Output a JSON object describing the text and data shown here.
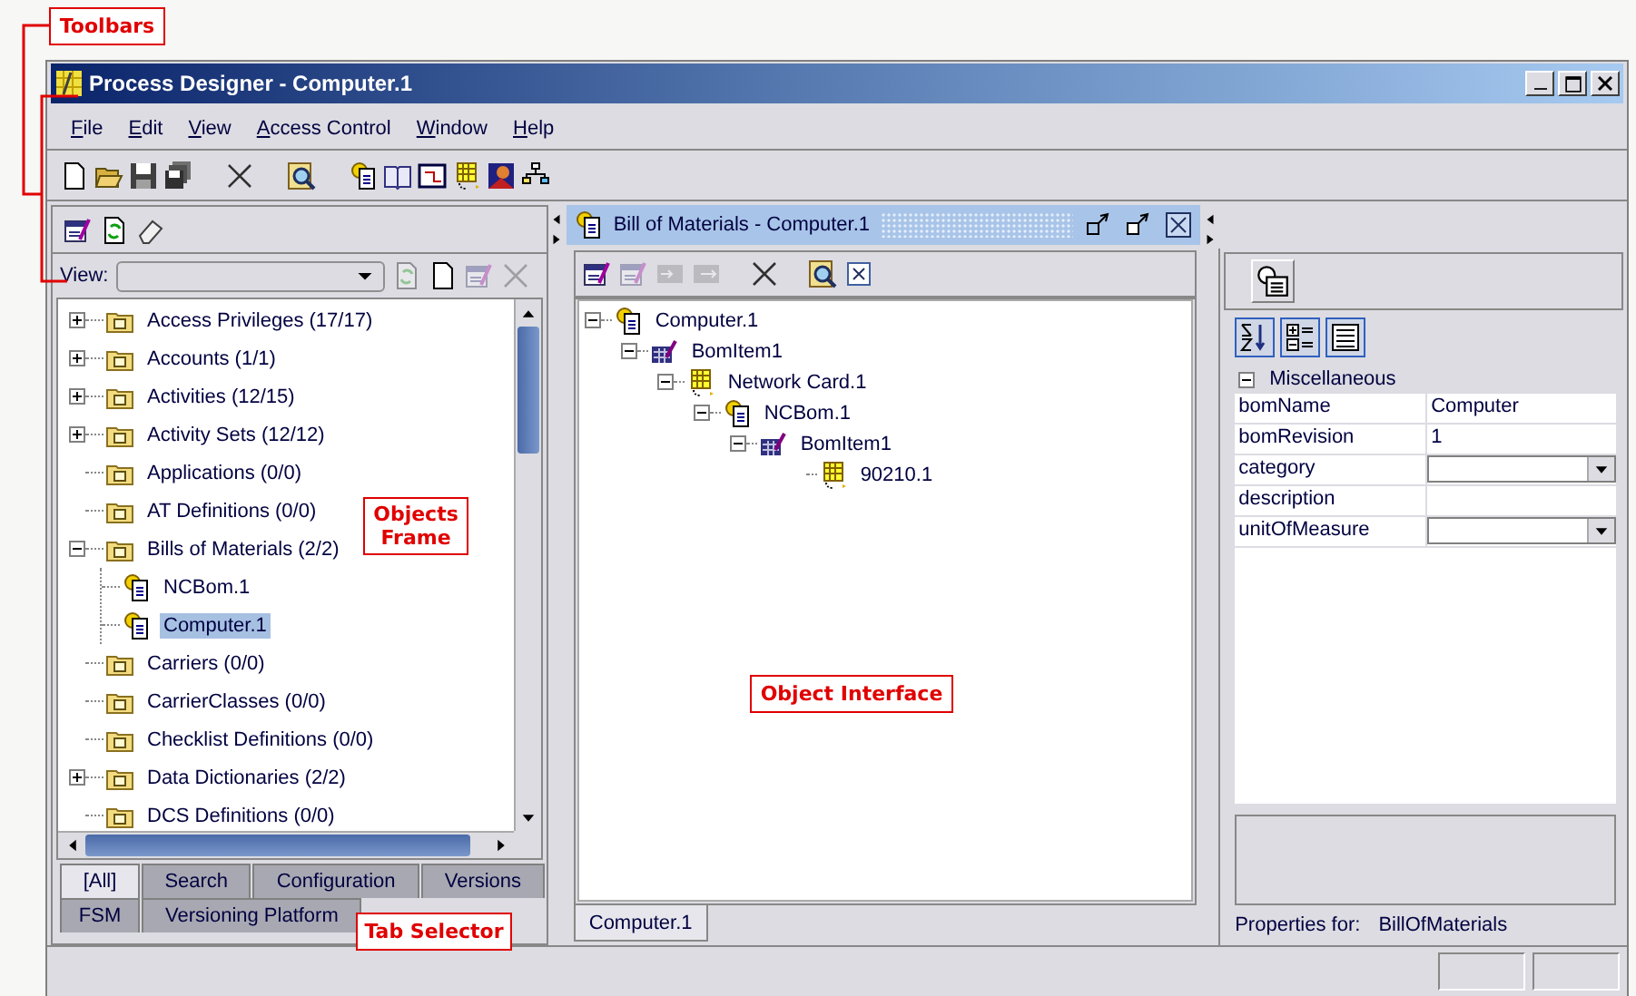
{
  "window": {
    "title": "Process Designer - Computer.1"
  },
  "menu": [
    "File",
    "Edit",
    "View",
    "Access Control",
    "Window",
    "Help"
  ],
  "objects_panel": {
    "tools": [
      {
        "kind": "edit",
        "disabled": false
      },
      {
        "kind": "refresh",
        "disabled": false
      },
      {
        "kind": "eraser",
        "disabled": false
      }
    ],
    "view_label": "View:",
    "view_actions": [
      {
        "kind": "refresh",
        "disabled": true
      },
      {
        "kind": "new",
        "disabled": false
      },
      {
        "kind": "edit",
        "disabled": true
      },
      {
        "kind": "delete",
        "disabled": true
      }
    ],
    "tree": [
      {
        "label": "Access Privileges (17/17)",
        "kind": "folder",
        "expanded": false,
        "selected": false
      },
      {
        "label": "Accounts (1/1)",
        "kind": "folder",
        "expanded": false,
        "selected": false
      },
      {
        "label": "Activities (12/15)",
        "kind": "folder",
        "expanded": false,
        "selected": false
      },
      {
        "label": "Activity Sets (12/12)",
        "kind": "folder",
        "expanded": false,
        "selected": false
      },
      {
        "label": "Applications (0/0)",
        "kind": "folder",
        "selected": false
      },
      {
        "label": "AT Definitions (0/0)",
        "kind": "folder",
        "selected": false
      },
      {
        "label": "Bills of Materials (2/2)",
        "kind": "folder",
        "expanded": true,
        "selected": false,
        "children": [
          {
            "label": "NCBom.1",
            "kind": "bom",
            "selected": false
          },
          {
            "label": "Computer.1",
            "kind": "bom",
            "selected": true
          }
        ]
      },
      {
        "label": "Carriers (0/0)",
        "kind": "folder",
        "selected": false
      },
      {
        "label": "CarrierClasses (0/0)",
        "kind": "folder",
        "selected": false
      },
      {
        "label": "Checklist Definitions (0/0)",
        "kind": "folder",
        "selected": false
      },
      {
        "label": "Data Dictionaries (2/2)",
        "kind": "folder",
        "expanded": false,
        "selected": false
      },
      {
        "label": "DCS Definitions (0/0)",
        "kind": "folder",
        "selected": false
      }
    ],
    "tab_rows": [
      {
        "tabs": [
          {
            "label": "[All]",
            "selected": true
          },
          {
            "label": "Search",
            "selected": false
          },
          {
            "label": "Configuration",
            "selected": false
          },
          {
            "label": "Versions",
            "selected": false
          }
        ]
      },
      {
        "tabs": [
          {
            "label": "FSM",
            "selected": false
          },
          {
            "label": "Versioning Platform",
            "selected": false
          }
        ]
      }
    ]
  },
  "editor": {
    "title": "Bill of Materials - Computer.1",
    "tools": [
      {
        "kind": "edit",
        "disabled": false
      },
      {
        "kind": "edit",
        "disabled": true
      },
      {
        "kind": "move-in",
        "disabled": true
      },
      {
        "kind": "move-out",
        "disabled": true
      },
      {
        "kind": "delete",
        "disabled": false
      },
      {
        "kind": "find",
        "disabled": false
      },
      {
        "kind": "close",
        "disabled": false
      }
    ],
    "tree": [
      {
        "label": "Computer.1",
        "kind": "bom",
        "expanded": true,
        "selected": false,
        "children": [
          {
            "label": "BomItem1",
            "kind": "bom-item",
            "expanded": true,
            "selected": false,
            "children": [
              {
                "label": "Network Card.1",
                "kind": "part",
                "expanded": true,
                "selected": false,
                "children": [
                  {
                    "label": "NCBom.1",
                    "kind": "bom",
                    "expanded": true,
                    "selected": false,
                    "children": [
                      {
                        "label": "BomItem1",
                        "kind": "bom-item",
                        "expanded": true,
                        "selected": false,
                        "children": [
                          {
                            "label": "90210.1",
                            "kind": "part",
                            "selected": false
                          }
                        ]
                      }
                    ]
                  }
                ]
              }
            ]
          }
        ]
      }
    ],
    "tabs": [
      {
        "label": "Computer.1",
        "selected": true
      }
    ]
  },
  "properties": {
    "section": {
      "label": "Miscellaneous",
      "expanded": true
    },
    "rows": [
      {
        "name": "bomName",
        "kind": "text",
        "value": "Computer"
      },
      {
        "name": "bomRevision",
        "kind": "text",
        "value": "1"
      },
      {
        "name": "category",
        "kind": "dropdown"
      },
      {
        "name": "description",
        "kind": "text"
      },
      {
        "name": "unitOfMeasure",
        "kind": "dropdown"
      }
    ],
    "footer_label": "Properties for:",
    "footer_value": "BillOfMaterials"
  },
  "callouts": [
    {
      "text": "Toolbars"
    },
    {
      "text": "Objects Frame"
    },
    {
      "text": "Object Interface"
    },
    {
      "text": "Tab Selector"
    }
  ]
}
